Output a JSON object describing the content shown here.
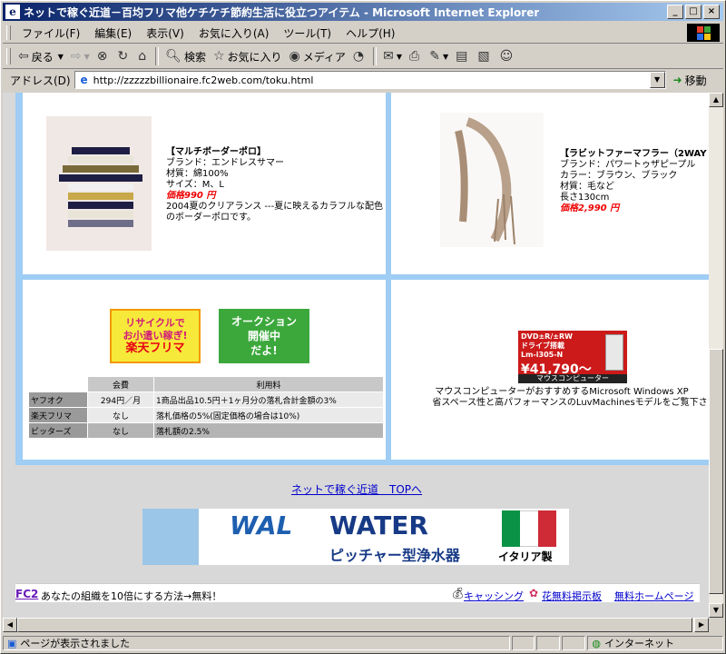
{
  "window": {
    "title": "ネットで稼ぐ近道－百均フリマ他ケチケチ節約生活に役立つアイテム - Microsoft Internet Explorer",
    "icon": "ie-icon"
  },
  "menu": [
    "ファイル(F)",
    "編集(E)",
    "表示(V)",
    "お気に入り(A)",
    "ツール(T)",
    "ヘルプ(H)"
  ],
  "toolbar": {
    "back": "戻る",
    "search": "検索",
    "favorites": "お気に入り",
    "media": "メディア"
  },
  "address": {
    "label": "アドレス(D)",
    "url": "http://zzzzzbillionaire.fc2web.com/toku.html",
    "go": "移動"
  },
  "products": [
    {
      "name": "【マルチボーダーポロ】",
      "brand": "ブランド：エンドレスサマー",
      "material": "材質：綿100%",
      "size": "サイズ：M、L",
      "price": "価格990 円",
      "desc1": "2004夏のクリアランス ---夏に映えるカラフルな配色",
      "desc2": "のボーダーポロです。"
    },
    {
      "name": "【ラビットファーマフラー（2WAY",
      "brand": "ブランド：パワートゥザピープル",
      "color": "カラー：ブラウン、ブラック",
      "material": "材質：毛など",
      "length": "長さ130cm",
      "price": "価格2,990 円"
    }
  ],
  "banners": {
    "rakuten_line1": "リサイクルで",
    "rakuten_line2": "お小遣い稼ぎ!",
    "rakuten_line3": "楽天フリマ",
    "auction_line1": "オークション",
    "auction_line2": "開催中",
    "auction_line3": "だよ!"
  },
  "fee_table": {
    "headers": [
      "",
      "会費",
      "利用料"
    ],
    "rows": [
      [
        "ヤフオク",
        "294円／月",
        "1商品出品10.5円＋1ヶ月分の落札合計金額の3%"
      ],
      [
        "楽天フリマ",
        "なし",
        "落札価格の5%(固定価格の場合は10%)"
      ],
      [
        "ビッターズ",
        "なし",
        "落札額の2.5%"
      ]
    ]
  },
  "mouse_ad": {
    "line1": "DVD±R/±RW",
    "line2": "ドライブ搭載",
    "model": "Lm-i305-N",
    "price": "¥41,790～",
    "brand": "マウスコンピューター",
    "desc1": "マウスコンピューターがおすすめするMicrosoft Windows XP",
    "desc2": "省スペース性と高パフォーマンスのLuvMachinesモデルをご覧下さい"
  },
  "top_link": "ネットで稼ぐ近道　TOPへ",
  "water_ad": {
    "wal": "WAL",
    "water": "WATER",
    "pitcher": "ピッチャー型浄水器",
    "italy": "イタリア製"
  },
  "fc2": {
    "logo": "FC2",
    "promo": "あなたの組織を10倍にする方法→無料！",
    "link1": "キャッシング",
    "link2": "花無料掲示板",
    "link3": "無料ホームページ"
  },
  "status": {
    "text": "ページが表示されました",
    "zone": "インターネット"
  },
  "colors": {
    "title_gradient_start": "#0a246a",
    "grid_border": "#9fcdf4",
    "price": "#e00000",
    "link": "#0000cc"
  }
}
